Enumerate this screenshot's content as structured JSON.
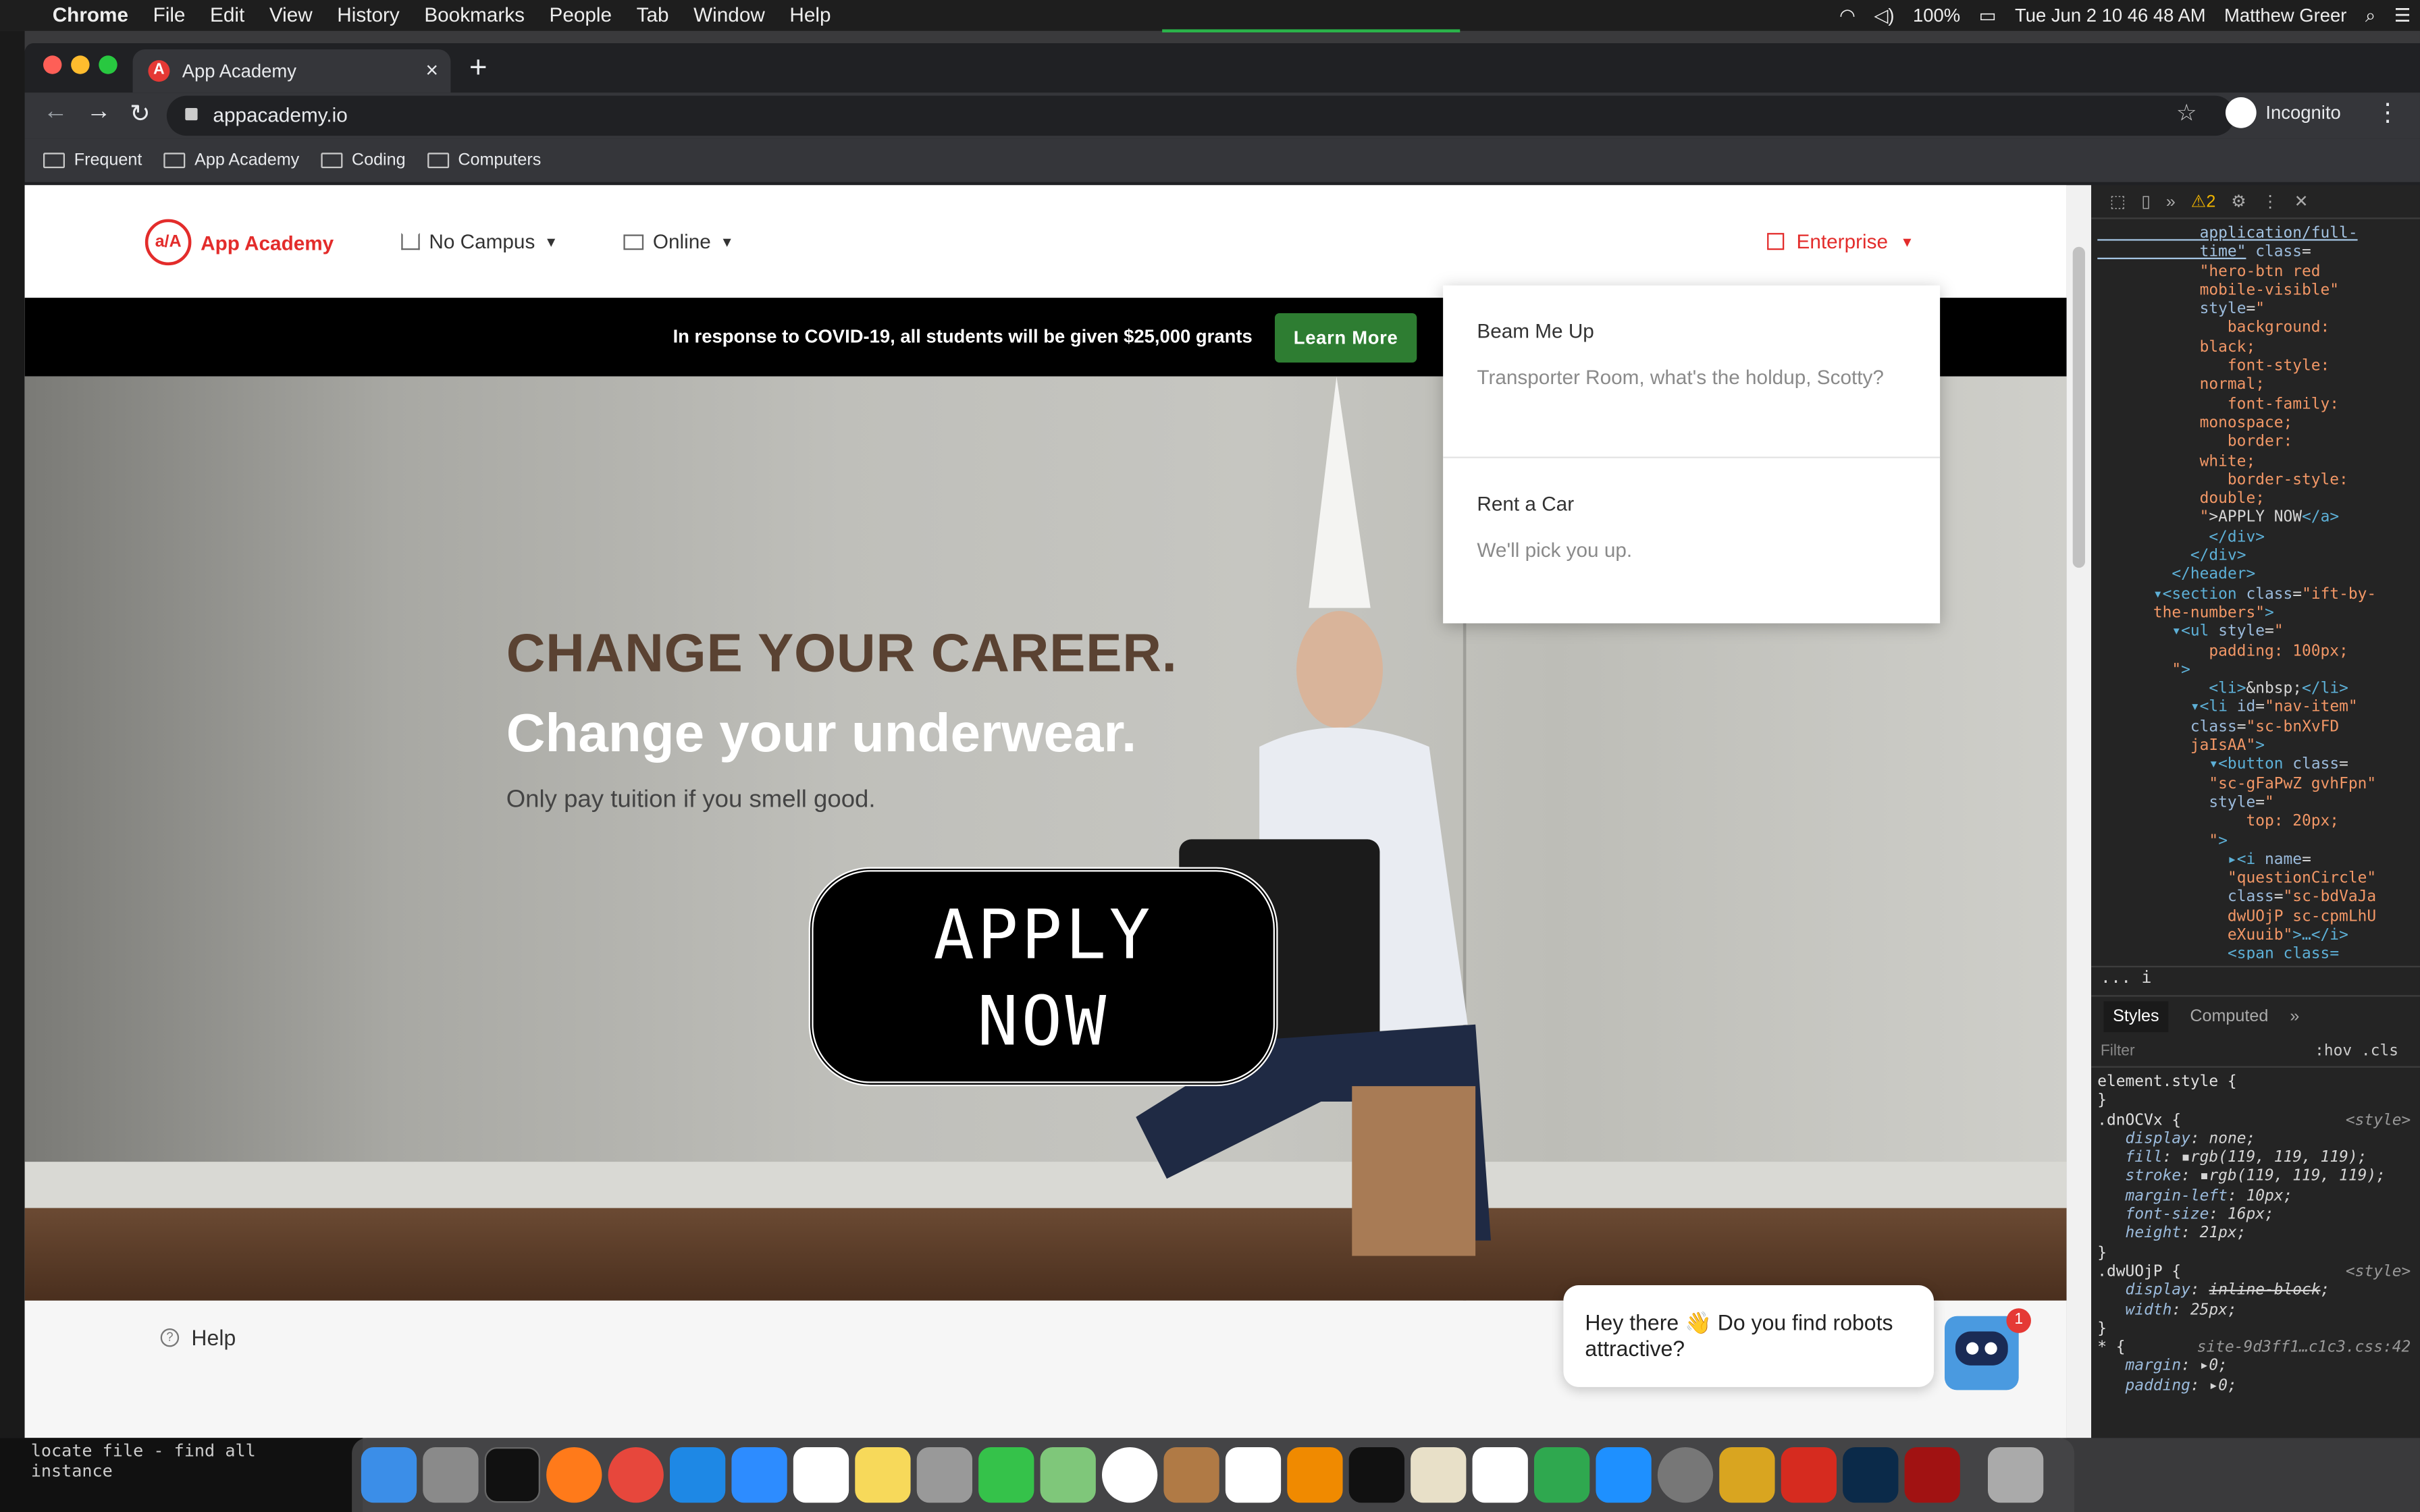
{
  "menubar": {
    "app": "Chrome",
    "items": [
      "File",
      "Edit",
      "View",
      "History",
      "Bookmarks",
      "People",
      "Tab",
      "Window",
      "Help"
    ],
    "battery": "100%",
    "datetime": "Tue Jun 2  10 46 48 AM",
    "user": "Matthew Greer"
  },
  "browser": {
    "tab_title": "App Academy",
    "url": "appacademy.io",
    "profile": "Incognito",
    "bookmarks": [
      "Frequent",
      "App Academy",
      "Coding",
      "Computers"
    ]
  },
  "site": {
    "logo_text": "App Academy",
    "logo_mark": "a/A",
    "nav": {
      "campus": "No Campus",
      "online": "Online",
      "enterprise": "Enterprise"
    },
    "banner": {
      "text": "In response to COVID-19, all students will be given $25,000 grants",
      "button": "Learn More"
    },
    "hero": {
      "headline": "CHANGE YOUR CAREER.",
      "subheadline": "Change your underwear.",
      "tagline": "Only pay tuition if you smell good.",
      "apply_line1": "APPLY",
      "apply_line2": "NOW"
    },
    "dropdown": [
      {
        "title": "Beam Me Up",
        "desc": "Transporter Room, what's the holdup, Scotty?"
      },
      {
        "title": "Rent a Car",
        "desc": "We'll pick you up."
      }
    ],
    "footer_help": "Help",
    "chat": {
      "message": "Hey there 👋 Do you find robots attractive?",
      "badge": "1"
    }
  },
  "devtools": {
    "warnings": "2",
    "tabs": [
      "Styles",
      "Computed"
    ],
    "filter_placeholder": "Filter",
    "filter_opts": ":hov .cls"
  },
  "terminal_text": "locate file - find all instance"
}
